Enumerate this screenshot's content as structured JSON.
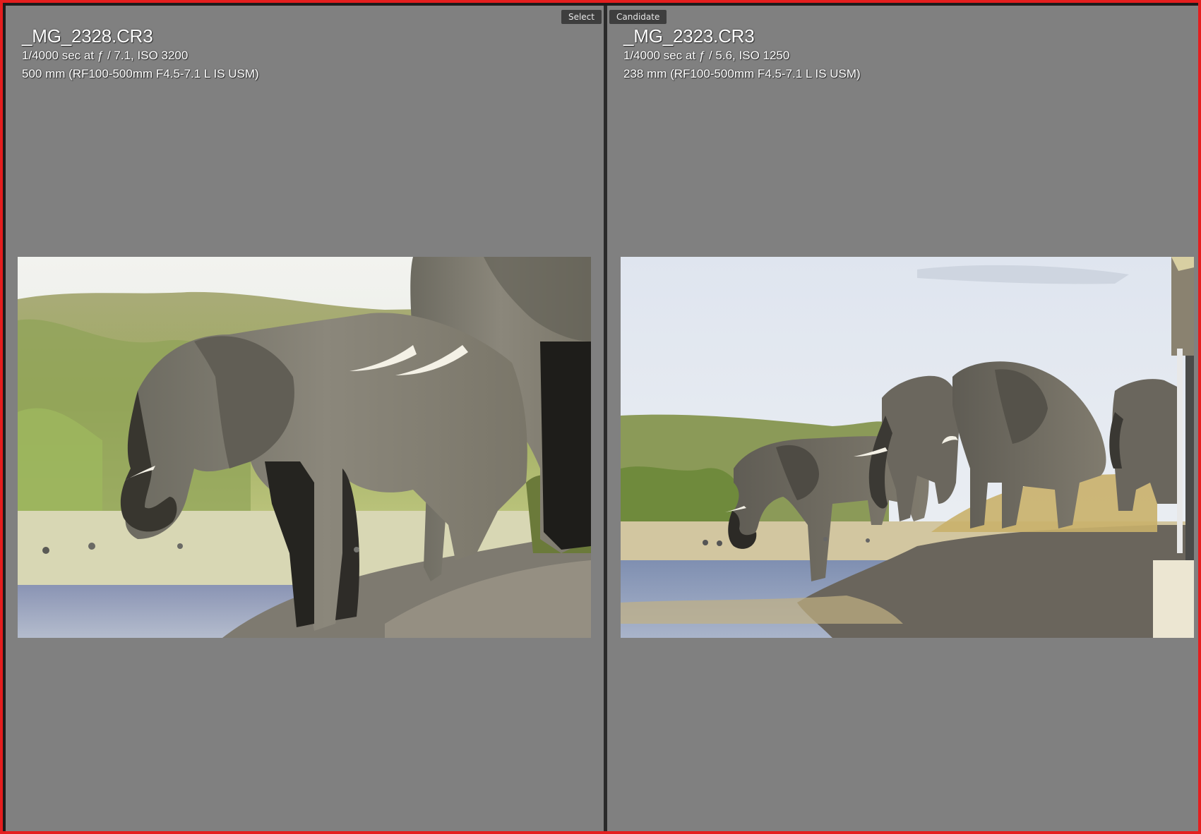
{
  "compare": {
    "select": {
      "tag": "Select",
      "filename": "_MG_2328.CR3",
      "exposure": "1/4000 sec at ƒ / 7.1, ISO 3200",
      "lens": "500 mm (RF100-500mm F4.5-7.1 L IS USM)",
      "image_alt": "Two African elephants at the water's edge, one drinking"
    },
    "candidate": {
      "tag": "Candidate",
      "filename": "_MG_2323.CR3",
      "exposure": "1/4000 sec at ƒ / 5.6, ISO 1250",
      "lens": "238 mm (RF100-500mm F4.5-7.1 L IS USM)",
      "image_alt": "A herd of elephants on a riverbank with a boat canopy at the right edge"
    }
  },
  "colors": {
    "frame_border": "#e41e1e",
    "pane_background": "#808080",
    "tag_background": "#3e3e3e"
  }
}
